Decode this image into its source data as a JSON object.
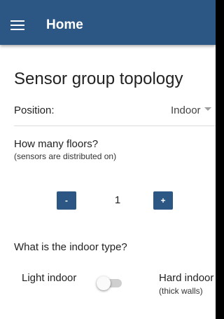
{
  "appbar": {
    "menu_icon": "hamburger-menu-icon",
    "title": "Home"
  },
  "page": {
    "title": "Sensor group topology"
  },
  "position": {
    "label": "Position:",
    "selected": "Indoor",
    "caret_icon": "dropdown-caret-icon"
  },
  "floors": {
    "question": "How many floors?",
    "subtitle": "(sensors are distributed on)",
    "decrement_label": "-",
    "value": "1",
    "increment_label": "+"
  },
  "indoor_type": {
    "question": "What is the indoor type?",
    "left_label": "Light indoor",
    "right_label": "Hard indoor",
    "right_sub": "(thick walls)",
    "toggle_on": false
  },
  "colors": {
    "accent": "#2c5784",
    "background": "#ffffff",
    "text": "#222222"
  }
}
